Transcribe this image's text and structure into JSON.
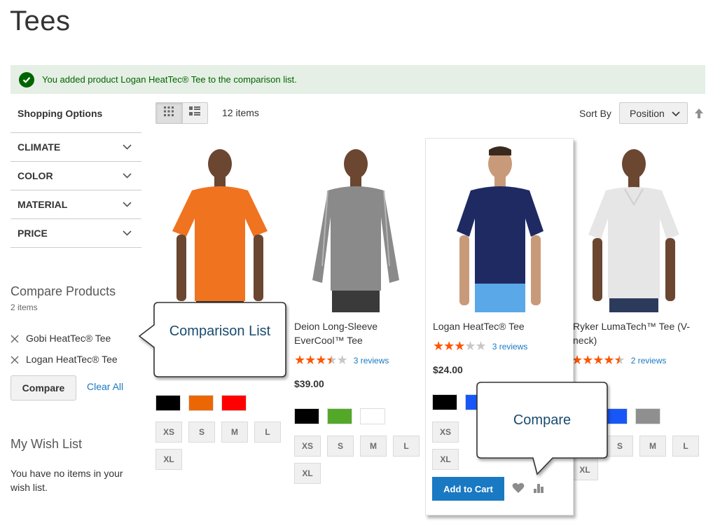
{
  "page": {
    "title": "Tees"
  },
  "message": {
    "text": "You added product Logan HeatTec® Tee to the comparison list."
  },
  "sidebar": {
    "title": "Shopping Options",
    "filters": [
      {
        "label": "CLIMATE"
      },
      {
        "label": "COLOR"
      },
      {
        "label": "MATERIAL"
      },
      {
        "label": "PRICE"
      }
    ],
    "compare": {
      "title": "Compare Products",
      "count": "2 items",
      "items": [
        {
          "name": "Gobi HeatTec® Tee"
        },
        {
          "name": "Logan HeatTec® Tee"
        }
      ],
      "compare_label": "Compare",
      "clear_label": "Clear All"
    },
    "wishlist": {
      "title": "My Wish List",
      "empty_text": "You have no items in your wish list."
    }
  },
  "toolbar": {
    "count": "12 items",
    "sort_label": "Sort By",
    "sort_value": "Position"
  },
  "products": [
    {
      "name": "",
      "shirt_color": "#f07320",
      "swatches": [
        "#000000",
        "#eb6703",
        "#ff0000"
      ],
      "sizes": [
        "XS",
        "S",
        "M",
        "L",
        "XL"
      ]
    },
    {
      "name": "Deion Long-Sleeve EverCool™ Tee",
      "shirt_color": "#8a8a8a",
      "rating": 3.5,
      "reviews": "3 reviews",
      "price": "$39.00",
      "swatches": [
        "#000000",
        "#53a828",
        "#ffffff"
      ],
      "sizes": [
        "XS",
        "S",
        "M",
        "L",
        "XL"
      ]
    },
    {
      "name": "Logan HeatTec® Tee",
      "shirt_color": "#1f2a63",
      "rating": 3,
      "reviews": "3 reviews",
      "price": "$24.00",
      "swatches": [
        "#000000",
        "#1857f7"
      ],
      "sizes": [
        "XS",
        "XL"
      ],
      "add_to_cart": "Add to Cart"
    },
    {
      "name": "Ryker LumaTech™ Tee (V-neck)",
      "name_line1": "Ryker LumaTech™ Tee (V-",
      "name_line2": "neck)",
      "shirt_color": "#e6e6e6",
      "rating": 4.5,
      "reviews": "2 reviews",
      "swatches": [
        "#1857f7",
        "#8f8f8f"
      ],
      "sizes": [
        "S",
        "M",
        "L",
        "XL"
      ]
    }
  ],
  "callouts": {
    "comparison_list": "Comparison List",
    "compare": "Compare"
  },
  "colors": {
    "accent": "#1979c3",
    "success_bg": "#e5efe5",
    "success_text": "#006400",
    "star": "#ff5501",
    "star_empty": "#c7c7c7"
  }
}
